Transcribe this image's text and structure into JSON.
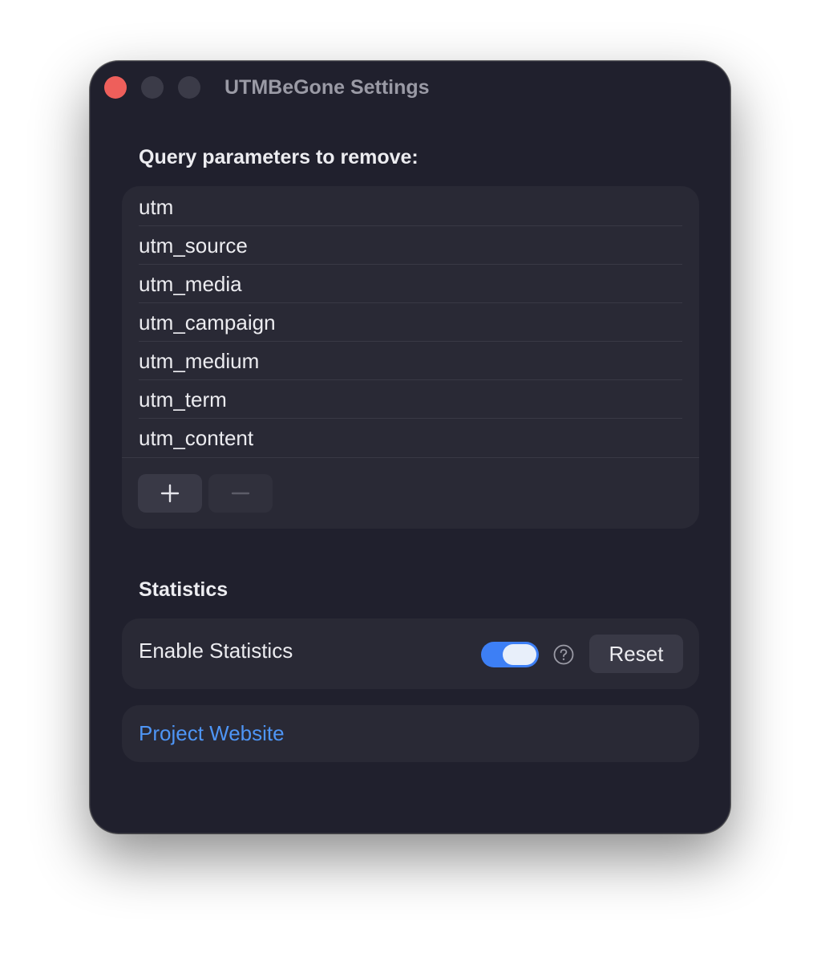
{
  "window": {
    "title": "UTMBeGone Settings"
  },
  "params_section": {
    "label": "Query parameters to remove:",
    "items": [
      "utm",
      "utm_source",
      "utm_media",
      "utm_campaign",
      "utm_medium",
      "utm_term",
      "utm_content"
    ],
    "add_icon": "plus-icon",
    "remove_icon": "minus-icon",
    "remove_enabled": false
  },
  "stats_section": {
    "label": "Statistics",
    "enable_label": "Enable Statistics",
    "enabled": true,
    "help_icon": "question-circle-icon",
    "reset_label": "Reset"
  },
  "links": {
    "website_label": "Project Website"
  },
  "colors": {
    "window_bg": "#20202d",
    "panel_bg": "#292935",
    "accent": "#3d7ff5",
    "link": "#4e95f5",
    "close_button": "#ee5f5b"
  }
}
